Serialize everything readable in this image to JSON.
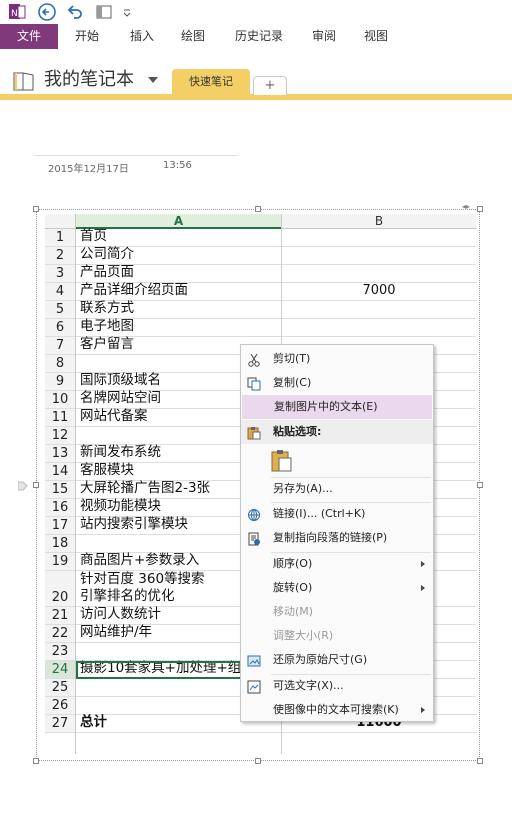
{
  "qat": {
    "icons": [
      "onenote-icon",
      "back-icon",
      "undo-icon",
      "dock-icon",
      "customize-icon"
    ]
  },
  "ribbon": {
    "file": "文件",
    "tabs": [
      "开始",
      "插入",
      "绘图",
      "历史记录",
      "审阅",
      "视图"
    ]
  },
  "notebook": {
    "title": "我的笔记本",
    "section_tab": "快速笔记",
    "add_tab": "+"
  },
  "page": {
    "date": "2015年12月17日",
    "time": "13:56"
  },
  "sheet": {
    "col_a": "A",
    "col_b": "B",
    "rows": [
      {
        "n": "1",
        "a": "首页",
        "b": ""
      },
      {
        "n": "2",
        "a": "公司简介",
        "b": ""
      },
      {
        "n": "3",
        "a": "产品页面",
        "b": ""
      },
      {
        "n": "4",
        "a": "产品详细介绍页面",
        "b": "7000"
      },
      {
        "n": "5",
        "a": "联系方式",
        "b": ""
      },
      {
        "n": "6",
        "a": "电子地图",
        "b": ""
      },
      {
        "n": "7",
        "a": "客户留言",
        "b": ""
      },
      {
        "n": "8",
        "a": "",
        "b": ""
      },
      {
        "n": "9",
        "a": "国际顶级域名",
        "b": ""
      },
      {
        "n": "10",
        "a": "名牌网站空间",
        "b": ""
      },
      {
        "n": "11",
        "a": "网站代备案",
        "b": ""
      },
      {
        "n": "12",
        "a": "",
        "b": ""
      },
      {
        "n": "13",
        "a": "新闻发布系统",
        "b": ""
      },
      {
        "n": "14",
        "a": "客服模块",
        "b": ""
      },
      {
        "n": "15",
        "a": "大屏轮播广告图2-3张",
        "b": ""
      },
      {
        "n": "16",
        "a": "视频功能模块",
        "b": ""
      },
      {
        "n": "17",
        "a": "站内搜索引擎模块",
        "b": ""
      },
      {
        "n": "18",
        "a": "",
        "b": ""
      },
      {
        "n": "19",
        "a": "商品图片+参数录入",
        "b": ""
      },
      {
        "n": "20",
        "a": "针对百度 360等搜索\n引擎排名的优化",
        "b": ""
      },
      {
        "n": "21",
        "a": "访问人数统计",
        "b": ""
      },
      {
        "n": "22",
        "a": "网站维护/年",
        "b": ""
      },
      {
        "n": "23",
        "a": "",
        "b": ""
      },
      {
        "n": "24",
        "a": "摄影10套家具+加处理+组",
        "b": ""
      },
      {
        "n": "25",
        "a": "",
        "b": ""
      },
      {
        "n": "26",
        "a": "",
        "b": ""
      },
      {
        "n": "27",
        "a": "总计",
        "b": "11600"
      }
    ]
  },
  "context_menu": {
    "items": [
      {
        "label": "剪切(T)",
        "icon": "scissors-icon"
      },
      {
        "label": "复制(C)",
        "icon": "copy-icon"
      },
      {
        "label": "复制图片中的文本(E)",
        "icon": ""
      },
      {
        "label": "粘贴选项:",
        "icon": "paste-icon"
      },
      {
        "label": "",
        "icon": "paste-option-icon"
      },
      {
        "label": "另存为(A)...",
        "icon": ""
      },
      {
        "label": "链接(I)...    (Ctrl+K)",
        "icon": "link-icon"
      },
      {
        "label": "复制指向段落的链接(P)",
        "icon": "paragraph-link-icon"
      },
      {
        "label": "顺序(O)",
        "icon": ""
      },
      {
        "label": "旋转(O)",
        "icon": ""
      },
      {
        "label": "移动(M)",
        "icon": ""
      },
      {
        "label": "调整大小(R)",
        "icon": ""
      },
      {
        "label": "还原为原始尺寸(G)",
        "icon": "restore-size-icon"
      },
      {
        "label": "可选文字(X)...",
        "icon": "alt-text-icon"
      },
      {
        "label": "使图像中的文本可搜索(K)",
        "icon": ""
      }
    ]
  },
  "colors": {
    "file_tab": "#80397b",
    "notebook_accent": "#f4cf66",
    "menu_highlight": "#e8dff0",
    "selected_row": "#c6dcc6"
  }
}
